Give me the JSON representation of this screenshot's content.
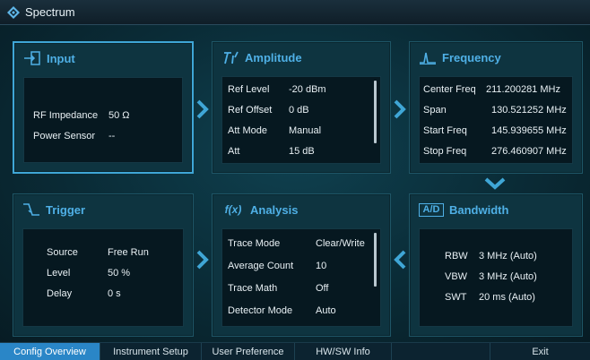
{
  "app": {
    "title": "Spectrum"
  },
  "panels": {
    "input": {
      "title": "Input",
      "rows": [
        {
          "label": "RF Impedance",
          "value": "50 Ω"
        },
        {
          "label": "Power Sensor",
          "value": "--"
        }
      ]
    },
    "amplitude": {
      "title": "Amplitude",
      "rows": [
        {
          "label": "Ref Level",
          "value": "-20 dBm"
        },
        {
          "label": "Ref Offset",
          "value": "0 dB"
        },
        {
          "label": "Att Mode",
          "value": "Manual"
        },
        {
          "label": "Att",
          "value": "15 dB"
        }
      ]
    },
    "frequency": {
      "title": "Frequency",
      "rows": [
        {
          "label": "Center Freq",
          "value": "211.200281 MHz"
        },
        {
          "label": "Span",
          "value": "130.521252 MHz"
        },
        {
          "label": "Start Freq",
          "value": "145.939655 MHz"
        },
        {
          "label": "Stop Freq",
          "value": "276.460907 MHz"
        }
      ]
    },
    "trigger": {
      "title": "Trigger",
      "rows": [
        {
          "label": "Source",
          "value": "Free Run"
        },
        {
          "label": "Level",
          "value": "50 %"
        },
        {
          "label": "Delay",
          "value": "0 s"
        }
      ]
    },
    "analysis": {
      "title": "Analysis",
      "icon_text": "f(x)",
      "rows": [
        {
          "label": "Trace Mode",
          "value": "Clear/Write"
        },
        {
          "label": "Average Count",
          "value": "10"
        },
        {
          "label": "Trace Math",
          "value": "Off"
        },
        {
          "label": "Detector Mode",
          "value": "Auto"
        }
      ]
    },
    "bandwidth": {
      "title": "Bandwidth",
      "icon_text": "A/D",
      "rows": [
        {
          "label": "RBW",
          "value": "3 MHz (Auto)"
        },
        {
          "label": "VBW",
          "value": "3 MHz (Auto)"
        },
        {
          "label": "SWT",
          "value": "20 ms (Auto)"
        }
      ]
    }
  },
  "bottom_tabs": [
    {
      "label": "Config Overview",
      "active": true
    },
    {
      "label": "Instrument Setup"
    },
    {
      "label": "User Preference"
    },
    {
      "label": "HW/SW Info"
    },
    {
      "label": "Exit"
    }
  ],
  "colors": {
    "accent": "#3fa6d6",
    "title_blue": "#4fb0e6",
    "active_tab": "#2a86c7"
  },
  "icons": {
    "app": "rs-logo-icon",
    "input": "input-arrow-icon",
    "amplitude": "amplitude-icon",
    "frequency": "frequency-pulse-icon",
    "trigger": "trigger-edge-icon",
    "analysis": "function-icon",
    "bandwidth": "ad-icon"
  }
}
